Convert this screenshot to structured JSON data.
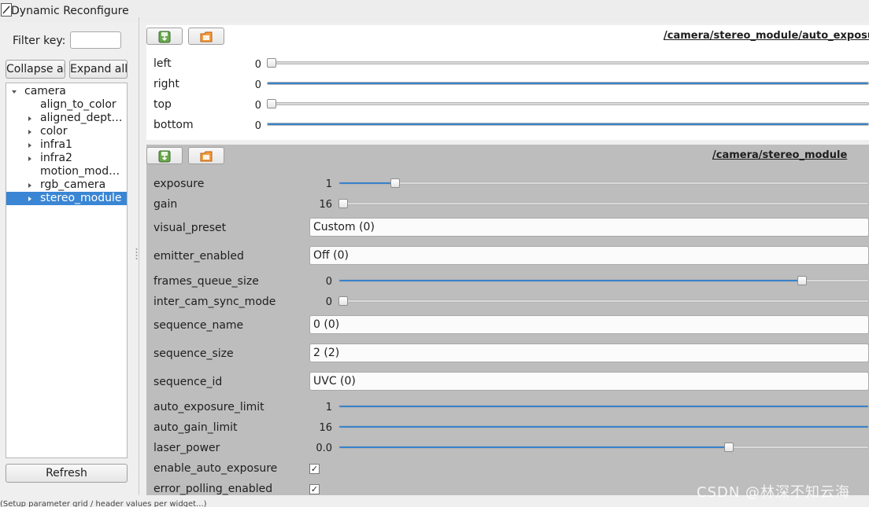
{
  "window": {
    "title": "Dynamic Reconfigure"
  },
  "sidebar": {
    "filter_label": "Filter key:",
    "filter_value": "",
    "collapse_all": "Collapse all",
    "expand_all": "Expand all",
    "refresh": "Refresh",
    "tree": [
      {
        "label": "camera",
        "expanded": true,
        "has_children": true,
        "selected": false
      },
      {
        "label": "align_to_color",
        "has_children": false,
        "selected": false
      },
      {
        "label": "aligned_dept…",
        "has_children": true,
        "selected": false
      },
      {
        "label": "color",
        "has_children": true,
        "selected": false
      },
      {
        "label": "infra1",
        "has_children": true,
        "selected": false
      },
      {
        "label": "infra2",
        "has_children": true,
        "selected": false
      },
      {
        "label": "motion_mod…",
        "has_children": false,
        "selected": false
      },
      {
        "label": "rgb_camera",
        "has_children": true,
        "selected": false
      },
      {
        "label": "stereo_module",
        "has_children": true,
        "selected": true
      }
    ]
  },
  "panel_roi": {
    "title": "/camera/stereo_module/auto_exposure_",
    "save_icon": "save-icon",
    "load_icon": "folder-icon",
    "params": [
      {
        "name": "left",
        "value": "0",
        "fraction": 0.0
      },
      {
        "name": "right",
        "value": "0",
        "fraction": 1.0
      },
      {
        "name": "top",
        "value": "0",
        "fraction": 0.0
      },
      {
        "name": "bottom",
        "value": "0",
        "fraction": 1.0
      }
    ]
  },
  "panel_stereo": {
    "title": "/camera/stereo_module",
    "save_icon": "save-icon",
    "load_icon": "folder-icon",
    "exposure": {
      "name": "exposure",
      "value": "1",
      "fraction": 0.1
    },
    "gain": {
      "name": "gain",
      "value": "16",
      "fraction": 0.0
    },
    "visual_preset": {
      "name": "visual_preset",
      "value": "Custom (0)"
    },
    "emitter_enabled": {
      "name": "emitter_enabled",
      "value": "Off (0)"
    },
    "frames_queue_size": {
      "name": "frames_queue_size",
      "value": "0",
      "fraction": 0.88
    },
    "inter_cam_sync_mode": {
      "name": "inter_cam_sync_mode",
      "value": "0",
      "fraction": 0.0
    },
    "sequence_name": {
      "name": "sequence_name",
      "value": "0 (0)"
    },
    "sequence_size": {
      "name": "sequence_size",
      "value": "2 (2)"
    },
    "sequence_id": {
      "name": "sequence_id",
      "value": "UVC (0)"
    },
    "auto_exposure_limit": {
      "name": "auto_exposure_limit",
      "value": "1",
      "fraction": 1.0
    },
    "auto_gain_limit": {
      "name": "auto_gain_limit",
      "value": "16",
      "fraction": 1.0
    },
    "laser_power": {
      "name": "laser_power",
      "value": "0.0",
      "fraction": 0.74
    },
    "enable_auto_exposure": {
      "name": "enable_auto_exposure",
      "checked": true
    },
    "error_polling_enabled": {
      "name": "error_polling_enabled",
      "checked": true
    }
  },
  "status_text": "(Setup parameter grid / header values per widget...)",
  "watermark": "CSDN @林深不知云海",
  "colors": {
    "accent": "#3883cc",
    "selection": "#3a86d4",
    "panel_bg": "#bdbdbd"
  }
}
